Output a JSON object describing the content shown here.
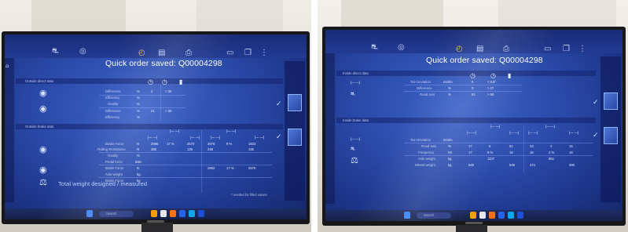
{
  "left": {
    "title": "Quick order saved: Q00004298",
    "sidebar_items": [
      "Outside direct data",
      "Outside brake data"
    ],
    "top_rows": [
      "Difference",
      "Efficiency",
      "Ovality",
      "Difference",
      "Efficiency"
    ],
    "top_units": [
      "%",
      "%",
      "%",
      "%",
      "%"
    ],
    "top_values": [
      [
        "2",
        "> 30",
        ""
      ],
      [
        "",
        "",
        ""
      ],
      [
        "",
        "",
        ""
      ],
      [
        "21",
        "> 30",
        ""
      ],
      [
        "",
        "",
        ""
      ]
    ],
    "bottom_rows": [
      "Brake Force",
      "Rolling Resistance",
      "Ovality",
      "Pedal force",
      "Brake Force",
      "Axle weight",
      "Brake Force"
    ],
    "bottom_units": [
      "N",
      "N",
      "%",
      "daN",
      "N",
      "kg",
      "kg"
    ],
    "bottom_values": [
      [
        "2996",
        "17 %",
        "2570",
        "2570",
        "9 %",
        "1823"
      ],
      [
        "385",
        "",
        "135",
        "248",
        "",
        "195"
      ],
      [
        "",
        "",
        "",
        "",
        "",
        ""
      ],
      [
        "",
        "",
        "",
        "",
        "",
        ""
      ],
      [
        "",
        "",
        "",
        "2992",
        "17 %",
        "2570"
      ],
      [
        "",
        "",
        "",
        "",
        "",
        ""
      ],
      [
        "",
        "",
        "",
        "",
        "",
        ""
      ]
    ],
    "total_label": "Total weight designed / measured",
    "footnote": "* needed for filled values",
    "taskbar_search": "Search"
  },
  "right": {
    "title": "Quick order saved: Q00004298",
    "sidebar_items": [
      "Inside direct data",
      "Inside brake data"
    ],
    "top_header": [
      "Toe Deviation",
      "mm/m"
    ],
    "top_rows": [
      "Difference",
      "Road axis"
    ],
    "top_units": [
      "%",
      "%"
    ],
    "top_values": [
      [
        "0",
        "< 0.8°"
      ],
      [
        "0",
        "> 27"
      ],
      [
        "61",
        "> 58"
      ]
    ],
    "bottom_header": [
      "Toe Deviation",
      "mm/m"
    ],
    "bottom_rows": [
      "Road axis",
      "Frequency",
      "Axle weight",
      "Wheel weight"
    ],
    "bottom_units": [
      "%",
      "Hz",
      "kg",
      "kg"
    ],
    "bottom_values": [
      [
        "17",
        "6",
        "51",
        "24",
        "2",
        "16"
      ],
      [
        "17",
        "6 %",
        "16",
        "16",
        "2 %",
        "18"
      ],
      [
        "",
        "1107",
        "",
        "",
        "851",
        ""
      ],
      [
        "526",
        "",
        "549",
        "474",
        "",
        "396"
      ]
    ],
    "taskbar_search": "Search"
  },
  "colors": {
    "screen": "#2a4aa8",
    "accent": "#f5c542",
    "bezel": "#18181a"
  },
  "icons": [
    "car-icon",
    "wheel-icon",
    "clock-icon",
    "printer-icon",
    "check-icon",
    "weight-icon"
  ]
}
